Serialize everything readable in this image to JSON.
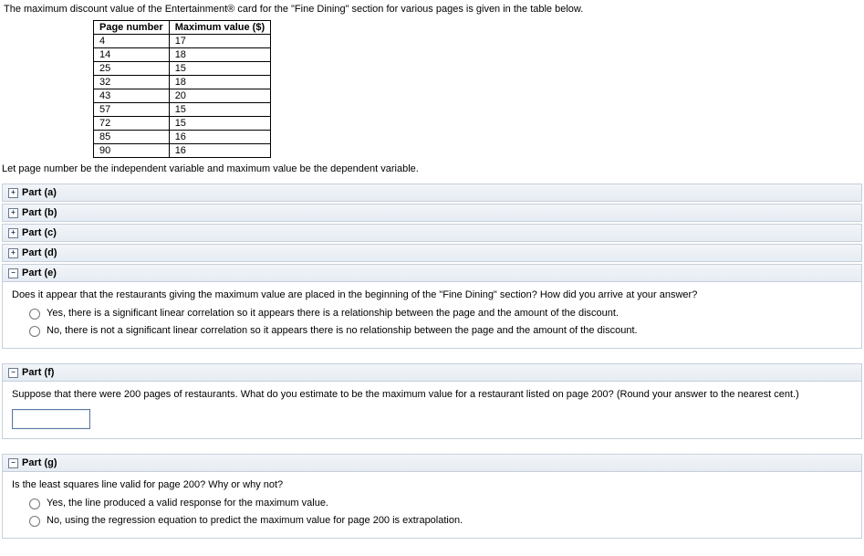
{
  "intro_text": "The maximum discount value of the Entertainment® card for the \"Fine Dining\" section for various pages is given in the table below.",
  "table": {
    "headers": {
      "col1": "Page number",
      "col2": "Maximum value ($)"
    },
    "rows": [
      {
        "page": "4",
        "value": "17"
      },
      {
        "page": "14",
        "value": "18"
      },
      {
        "page": "25",
        "value": "15"
      },
      {
        "page": "32",
        "value": "18"
      },
      {
        "page": "43",
        "value": "20"
      },
      {
        "page": "57",
        "value": "15"
      },
      {
        "page": "72",
        "value": "15"
      },
      {
        "page": "85",
        "value": "16"
      },
      {
        "page": "90",
        "value": "16"
      }
    ]
  },
  "vars_note": "Let page number be the independent variable and maximum value be the dependent variable.",
  "toggles": {
    "plus": "+",
    "minus": "−"
  },
  "parts": {
    "a": {
      "label": "Part (a)"
    },
    "b": {
      "label": "Part (b)"
    },
    "c": {
      "label": "Part (c)"
    },
    "d": {
      "label": "Part (d)"
    },
    "e": {
      "label": "Part (e)",
      "question": "Does it appear that the restaurants giving the maximum value are placed in the beginning of the \"Fine Dining\" section? How did you arrive at your answer?",
      "opt1": "Yes, there is a significant linear correlation so it appears there is a relationship between the page and the amount of the discount.",
      "opt2": "No, there is not a significant linear correlation so it appears there is no relationship between the page and the amount of the discount."
    },
    "f": {
      "label": "Part (f)",
      "question": "Suppose that there were 200 pages of restaurants. What do you estimate to be the maximum value for a restaurant listed on page 200? (Round your answer to the nearest cent.)"
    },
    "g": {
      "label": "Part (g)",
      "question": "Is the least squares line valid for page 200? Why or why not?",
      "opt1": "Yes, the line produced a valid response for the maximum value.",
      "opt2": "No, using the regression equation to predict the maximum value for page 200 is extrapolation."
    }
  }
}
